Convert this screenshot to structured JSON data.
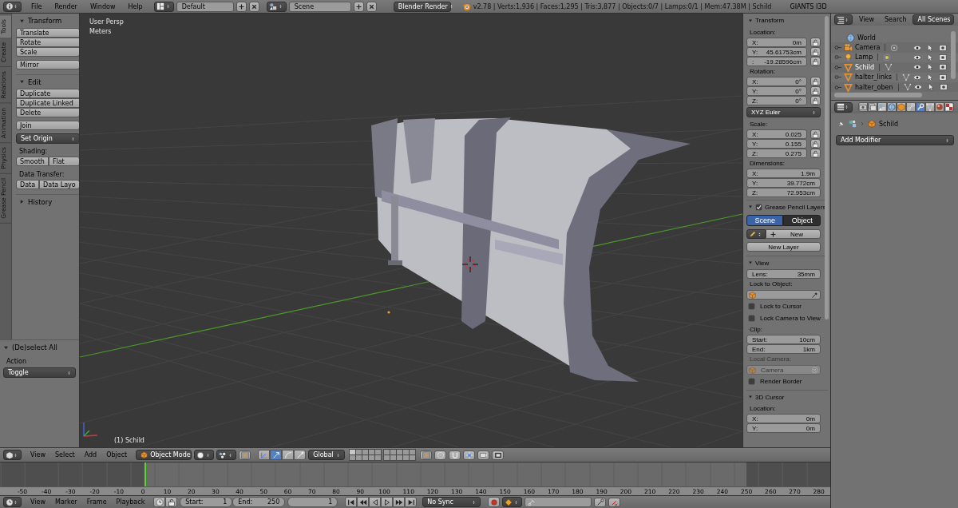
{
  "top_bar": {
    "menus": [
      "File",
      "Render",
      "Window",
      "Help"
    ],
    "layout": "Default",
    "scene": "Scene",
    "engine": "Blender Render",
    "stats": "v2.78 | Verts:1,936 | Faces:1,295 | Tris:3,877 | Objects:0/7 | Lamps:0/1 | Mem:47.38M | Schild",
    "brand": "GIANTS I3D"
  },
  "tool_tabs": [
    {
      "label": "Tools",
      "selected": true
    },
    {
      "label": "Create",
      "selected": false
    },
    {
      "label": "Relations",
      "selected": false
    },
    {
      "label": "Animation",
      "selected": false
    },
    {
      "label": "Physics",
      "selected": false
    },
    {
      "label": "Grease Pencil",
      "selected": false
    }
  ],
  "tool_shelf": [
    {
      "kind": "header",
      "title": "Transform",
      "expanded": true
    },
    {
      "kind": "column",
      "buttons": [
        "Translate",
        "Rotate",
        "Scale"
      ]
    },
    {
      "kind": "column",
      "buttons": [
        "Mirror"
      ]
    },
    {
      "kind": "header",
      "title": "Edit",
      "expanded": true
    },
    {
      "kind": "column",
      "buttons": [
        "Duplicate",
        "Duplicate Linked",
        "Delete"
      ]
    },
    {
      "kind": "column",
      "buttons": [
        "Join"
      ]
    },
    {
      "kind": "dropdown",
      "text": "Set Origin"
    },
    {
      "kind": "label",
      "text": "Shading:"
    },
    {
      "kind": "row",
      "buttons": [
        "Smooth",
        "Flat"
      ]
    },
    {
      "kind": "label",
      "text": "Data Transfer:"
    },
    {
      "kind": "row",
      "buttons": [
        "Data",
        "Data Layo"
      ]
    },
    {
      "kind": "header",
      "title": "History",
      "expanded": false
    }
  ],
  "operator_panel": {
    "title": "(De)select All",
    "expanded": true,
    "label": "Action",
    "dropdown": "Toggle"
  },
  "viewport": {
    "view_name": "User Persp",
    "units": "Meters",
    "active_object": "(1) Schild"
  },
  "n_panel": [
    {
      "kind": "header",
      "title": "Transform",
      "expanded": true
    },
    {
      "kind": "label",
      "text": "Location:"
    },
    {
      "kind": "field",
      "label": "X:",
      "value": "0m",
      "lock": true
    },
    {
      "kind": "field",
      "label": "Y:",
      "value": "45.61753cm",
      "lock": true
    },
    {
      "kind": "field",
      "label": ":",
      "value": "-19.28596cm",
      "lock": true
    },
    {
      "kind": "label",
      "text": "Rotation:"
    },
    {
      "kind": "field",
      "label": "X:",
      "value": "0°",
      "lock": true
    },
    {
      "kind": "field",
      "label": "Y:",
      "value": "0°",
      "lock": true
    },
    {
      "kind": "field",
      "label": "Z:",
      "value": "0°",
      "lock": true
    },
    {
      "kind": "dropdown",
      "text": "XYZ Euler"
    },
    {
      "kind": "label",
      "text": "Scale:"
    },
    {
      "kind": "field",
      "label": "X:",
      "value": "0.025",
      "lock": true
    },
    {
      "kind": "field",
      "label": "Y:",
      "value": "0.155",
      "lock": true
    },
    {
      "kind": "field",
      "label": "Z:",
      "value": "0.275",
      "lock": true
    },
    {
      "kind": "label",
      "text": "Dimensions:"
    },
    {
      "kind": "field",
      "label": "X:",
      "value": "1.9m",
      "lock": false
    },
    {
      "kind": "field",
      "label": "Y:",
      "value": "39.772cm",
      "lock": false
    },
    {
      "kind": "field",
      "label": "Z:",
      "value": "72.953cm",
      "lock": false
    },
    {
      "kind": "header",
      "title": "Grease Pencil Layers",
      "expanded": true,
      "checked": true
    },
    {
      "kind": "tabs",
      "items": [
        {
          "label": "Scene",
          "selected": true
        },
        {
          "label": "Object",
          "selected": false
        }
      ]
    },
    {
      "kind": "new",
      "text": "New"
    },
    {
      "kind": "button",
      "text": "New Layer"
    },
    {
      "kind": "header",
      "title": "View",
      "expanded": true
    },
    {
      "kind": "field",
      "label": "Lens:",
      "value": "35mm",
      "lock": false
    },
    {
      "kind": "label",
      "text": "Lock to Object:",
      "disabled": false
    },
    {
      "kind": "object_field",
      "disabled": false
    },
    {
      "kind": "checkbox",
      "text": "Lock to Cursor",
      "checked": false
    },
    {
      "kind": "checkbox",
      "text": "Lock Camera to View",
      "checked": false
    },
    {
      "kind": "label",
      "text": "Clip:"
    },
    {
      "kind": "field",
      "label": "Start:",
      "value": "10cm",
      "lock": false
    },
    {
      "kind": "field",
      "label": "End:",
      "value": "1km",
      "lock": false
    },
    {
      "kind": "label",
      "text": "Local Camera:",
      "disabled": true
    },
    {
      "kind": "object_field",
      "value": "Camera",
      "disabled": true
    },
    {
      "kind": "checkbox",
      "text": "Render Border",
      "checked": false
    },
    {
      "kind": "header",
      "title": "3D Cursor",
      "expanded": true
    },
    {
      "kind": "label",
      "text": "Location:"
    },
    {
      "kind": "field",
      "label": "X:",
      "value": "0m",
      "lock": false
    },
    {
      "kind": "field",
      "label": "Y:",
      "value": "0m",
      "lock": false
    }
  ],
  "view_header": {
    "menus": [
      "View",
      "Select",
      "Add",
      "Object"
    ],
    "mode": "Object Mode",
    "orientation": "Global"
  },
  "timeline": {
    "ticks": [
      "-50",
      "-40",
      "-30",
      "-20",
      "-10",
      "0",
      "10",
      "20",
      "30",
      "40",
      "50",
      "60",
      "70",
      "80",
      "90",
      "100",
      "110",
      "120",
      "130",
      "140",
      "150",
      "160",
      "170",
      "180",
      "190",
      "200",
      "210",
      "220",
      "230",
      "240",
      "250",
      "260",
      "270",
      "280"
    ]
  },
  "timeline_header": {
    "menus": [
      "View",
      "Marker",
      "Frame",
      "Playback"
    ],
    "start": {
      "label": "Start:",
      "value": "1"
    },
    "end": {
      "label": "End:",
      "value": "250"
    },
    "current": "1",
    "sync": "No Sync"
  },
  "outliner": {
    "menus": [
      "View",
      "Search"
    ],
    "filter": "All Scenes",
    "items": [
      {
        "name": "World",
        "kind": "world",
        "selected": false
      },
      {
        "name": "Camera",
        "kind": "camera",
        "selected": false
      },
      {
        "name": "Lamp",
        "kind": "lamp",
        "selected": false
      },
      {
        "name": "Schild",
        "kind": "mesh",
        "selected": true
      },
      {
        "name": "halter_links",
        "kind": "mesh",
        "selected": false
      },
      {
        "name": "halter_oben",
        "kind": "mesh",
        "selected": false
      }
    ]
  },
  "properties": {
    "tabs": [
      {
        "kind": "render",
        "selected": false
      },
      {
        "kind": "render_layers",
        "selected": false
      },
      {
        "kind": "scene",
        "selected": false
      },
      {
        "kind": "world",
        "selected": false
      },
      {
        "kind": "object",
        "selected": false
      },
      {
        "kind": "constraints",
        "selected": false
      },
      {
        "kind": "modifiers",
        "selected": true
      },
      {
        "kind": "data",
        "selected": false
      },
      {
        "kind": "material",
        "selected": false
      },
      {
        "kind": "texture",
        "selected": false
      }
    ],
    "breadcrumb": "Schild",
    "add_modifier": "Add Modifier"
  }
}
